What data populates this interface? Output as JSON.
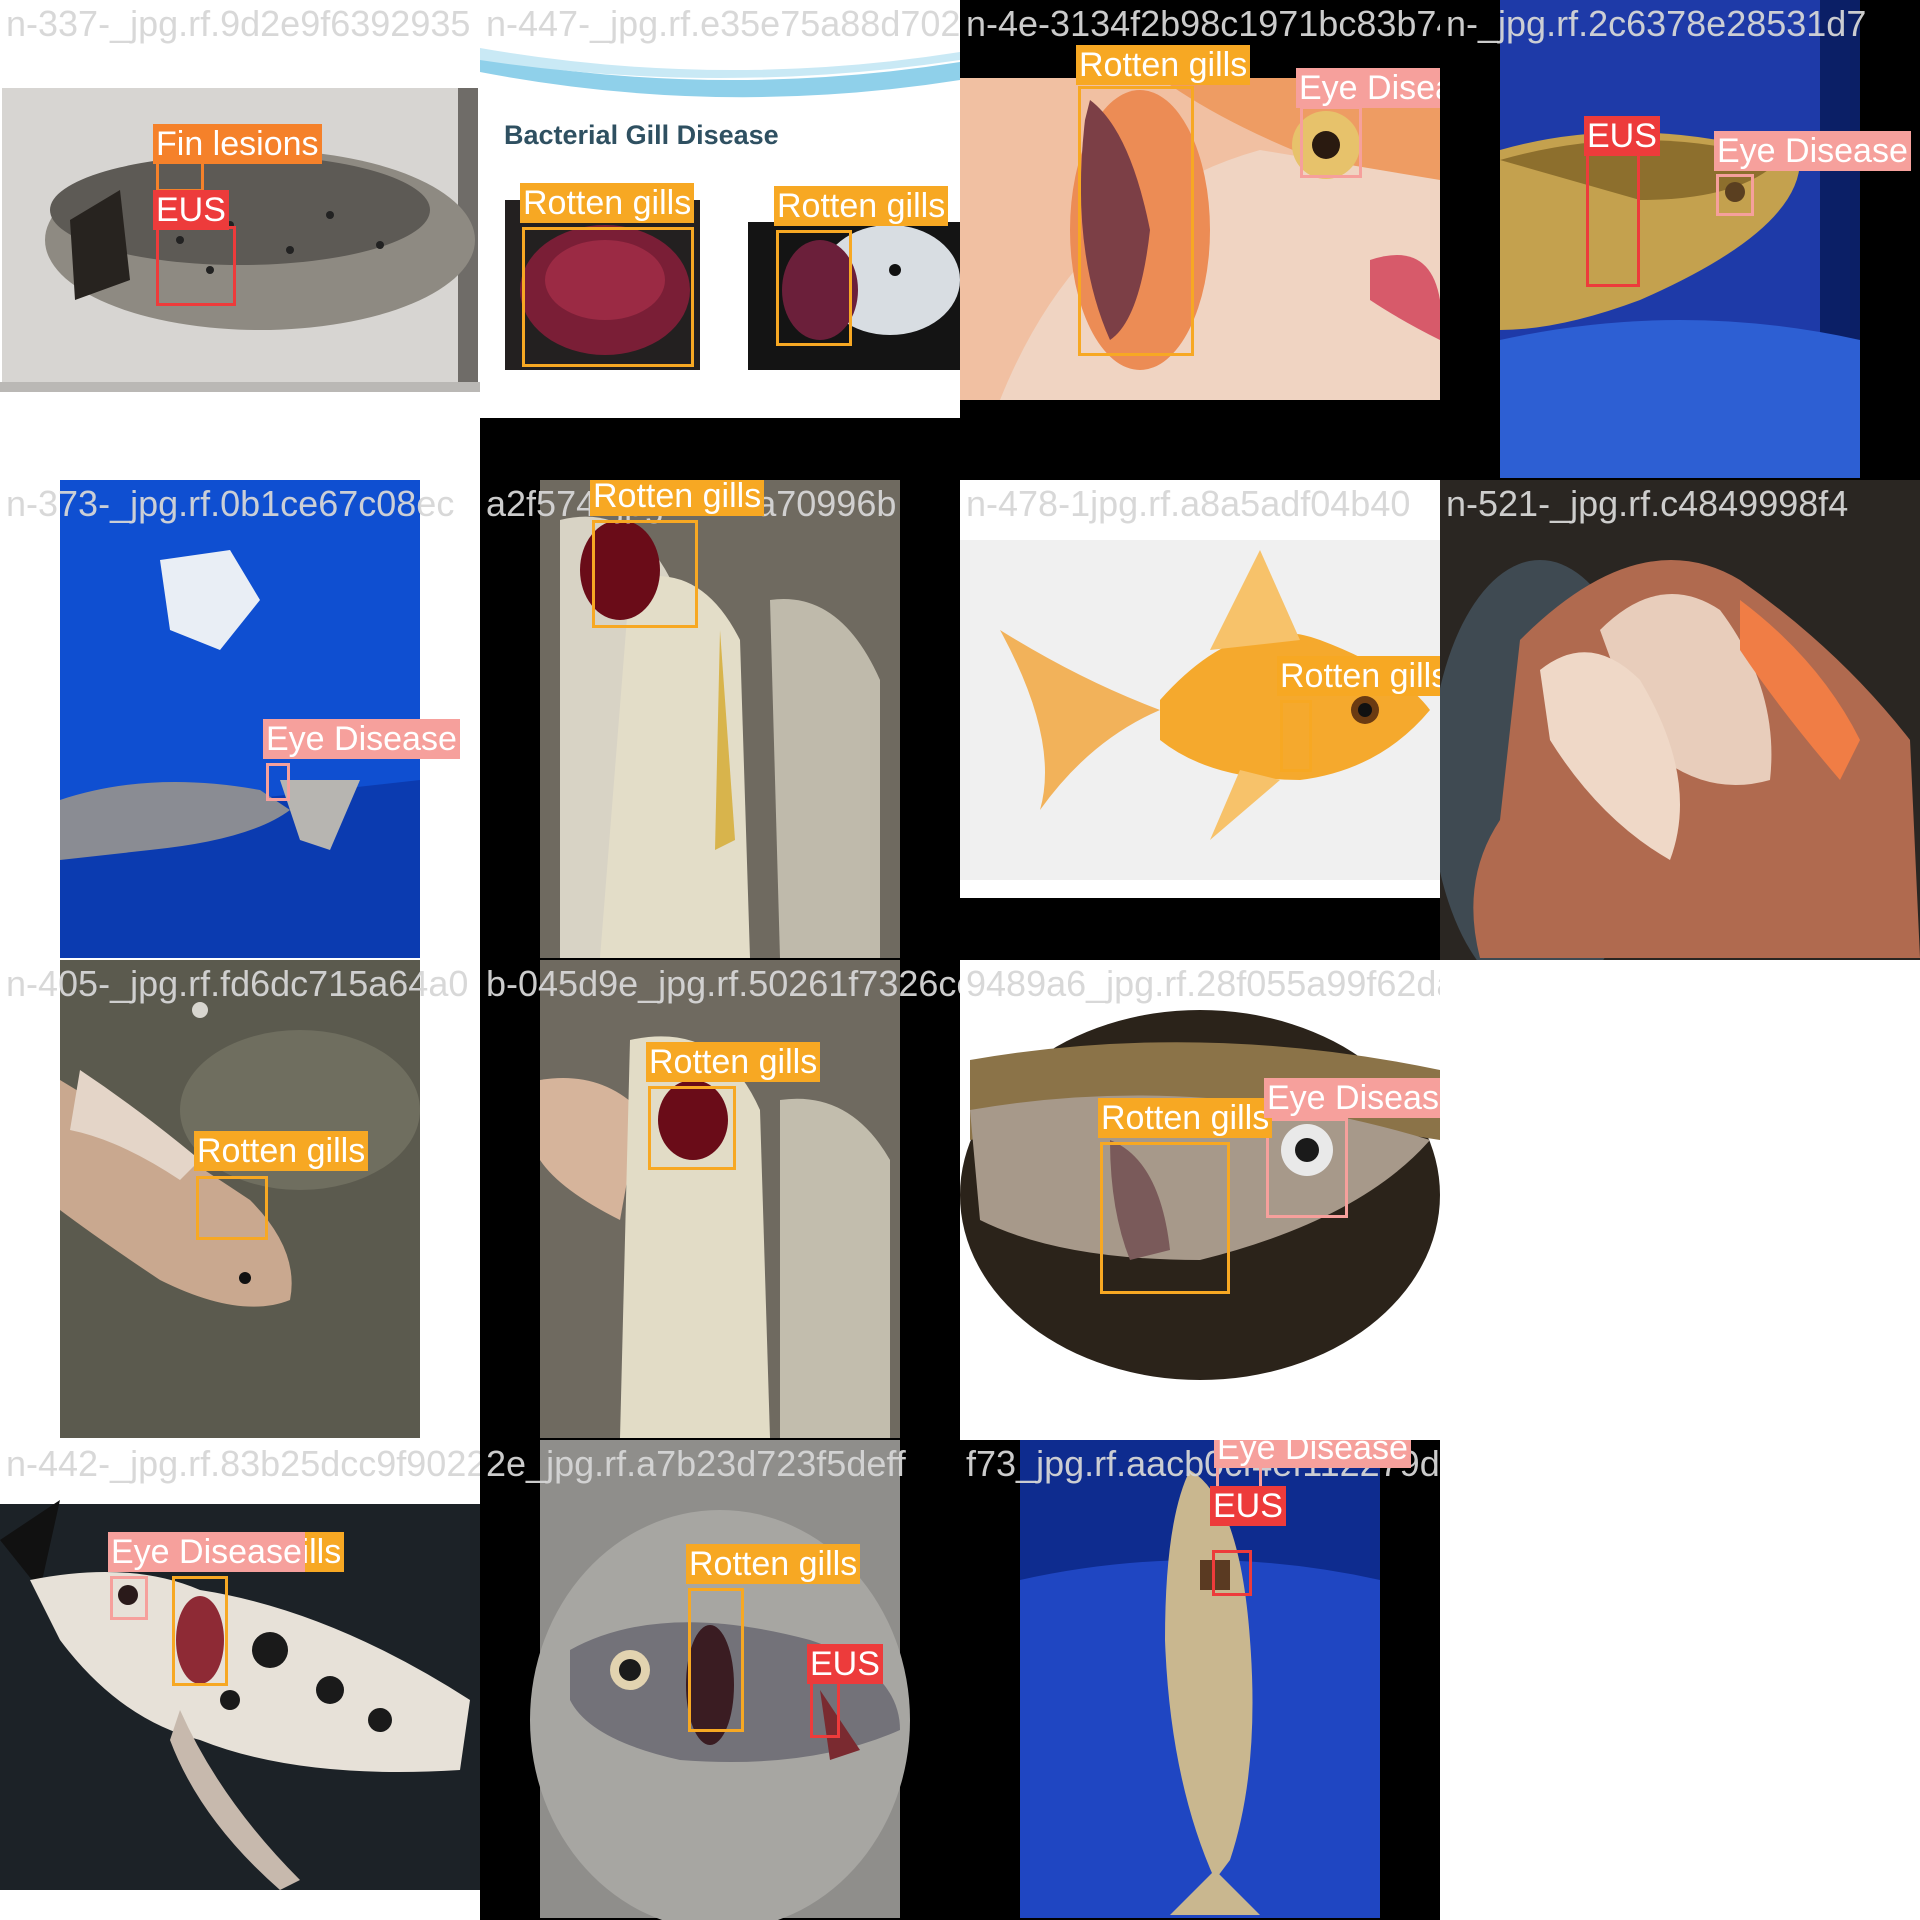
{
  "classes": {
    "Fin lesions": "#f5812a",
    "EUS": "#ed3b3b",
    "Rotten gills": "#f7a823",
    "Eye Disease": "#f6a09c"
  },
  "tiles": [
    {
      "filename": "n-337-_jpg.rf.9d2e9f6392935",
      "scene": "fish-on-white-tray",
      "detections": [
        {
          "label": "Fin lesions"
        },
        {
          "label": "EUS"
        }
      ]
    },
    {
      "filename": "n-447-_jpg.rf.e35e75a88d70224",
      "scene": "gill-slide",
      "slide_title": "Bacterial Gill Disease",
      "detections": [
        {
          "label": "Rotten gills"
        },
        {
          "label": "Rotten gills"
        }
      ]
    },
    {
      "filename": "n-4e-3134f2b98c1971bc83b745",
      "scene": "orange-fish-head",
      "detections": [
        {
          "label": "Rotten gills"
        },
        {
          "label": "Eye Disease"
        }
      ]
    },
    {
      "filename": "n-_jpg.rf.2c6378e28531d7",
      "scene": "fish-on-blue",
      "detections": [
        {
          "label": "EUS"
        },
        {
          "label": "Eye Disease"
        }
      ]
    },
    {
      "filename": "n-373-_jpg.rf.0b1ce67c08ec",
      "scene": "dead-fish-on-blue",
      "detections": [
        {
          "label": "Eye Disease"
        }
      ]
    },
    {
      "filename": "a2f574_jpg.rf.21fa70996b",
      "scene": "fish-on-ice",
      "detections": [
        {
          "label": "Rotten gills"
        }
      ]
    },
    {
      "filename": "n-478-1jpg.rf.a8a5adf04b40",
      "scene": "goldfish-white",
      "detections": [
        {
          "label": "Rotten gills"
        }
      ]
    },
    {
      "filename": "n-521-_jpg.rf.c4849998f4",
      "scene": "fish-in-hand",
      "detections": []
    },
    {
      "filename": "n-405-_jpg.rf.fd6dc715a64a0",
      "scene": "carp-on-stone",
      "detections": [
        {
          "label": "Rotten gills"
        }
      ]
    },
    {
      "filename": "b-045d9e_jpg.rf.50261f7326ce",
      "scene": "fish-held-gills",
      "detections": [
        {
          "label": "Rotten gills"
        }
      ]
    },
    {
      "filename": "9489a6_jpg.rf.28f055a99f62dae6a009f232940",
      "scene": "fish-dark-oval",
      "detections": [
        {
          "label": "Rotten gills"
        },
        {
          "label": "Eye Disease"
        }
      ]
    },
    {
      "filename": "",
      "scene": "empty",
      "detections": []
    },
    {
      "filename": "n-442-_jpg.rf.83b25dcc9f9022",
      "scene": "koi-dark",
      "detections": [
        {
          "label": "Rotten gills"
        },
        {
          "label": "Eye Disease"
        }
      ]
    },
    {
      "filename": "2e_jpg.rf.a7b23d723f5deff",
      "scene": "fish-on-metal",
      "detections": [
        {
          "label": "Rotten gills"
        },
        {
          "label": "EUS"
        }
      ]
    },
    {
      "filename": "f73_jpg.rf.aacb0cf4ef112279de824b1",
      "scene": "fish-vertical-blue",
      "detections": [
        {
          "label": "Eye Disease"
        },
        {
          "label": "EUS"
        }
      ]
    },
    {
      "filename": "",
      "scene": "empty",
      "detections": []
    }
  ]
}
